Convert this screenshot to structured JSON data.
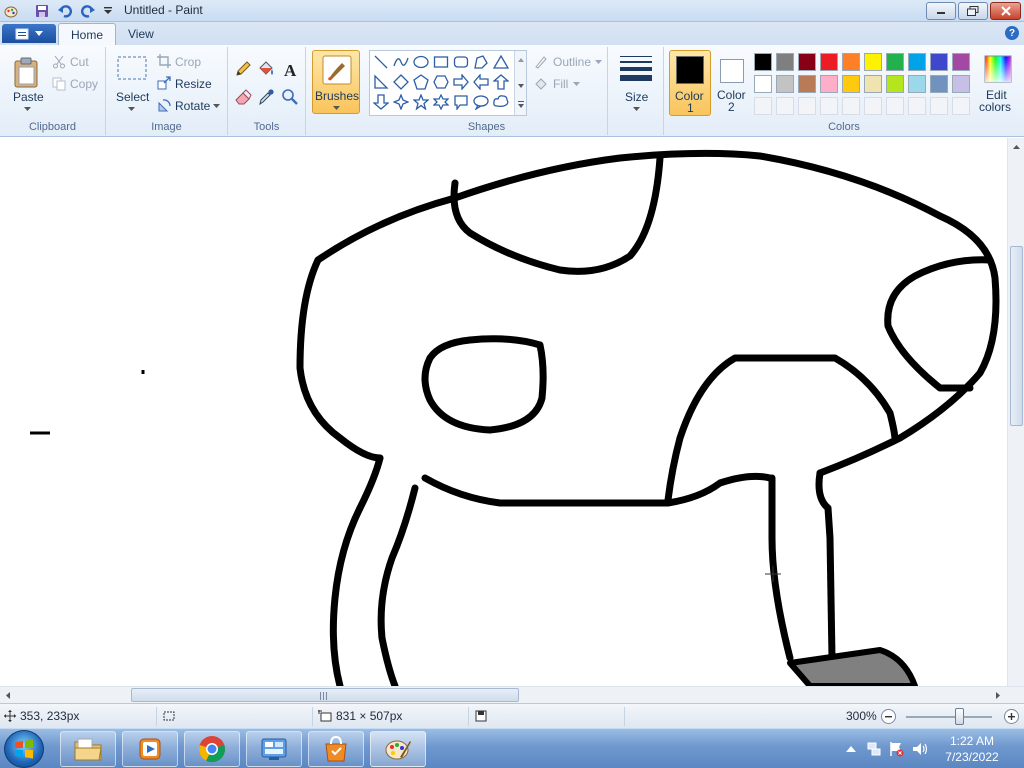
{
  "window": {
    "title": "Untitled - Paint"
  },
  "tabs": {
    "home": "Home",
    "view": "View"
  },
  "ribbon": {
    "clipboard": {
      "paste": "Paste",
      "cut": "Cut",
      "copy": "Copy",
      "group": "Clipboard"
    },
    "image": {
      "select": "Select",
      "crop": "Crop",
      "resize": "Resize",
      "rotate": "Rotate",
      "group": "Image"
    },
    "tools": {
      "group": "Tools"
    },
    "brushes": {
      "label": "Brushes"
    },
    "shapes": {
      "outline": "Outline",
      "fill": "Fill",
      "group": "Shapes"
    },
    "size": {
      "label": "Size"
    },
    "colors": {
      "color1": "Color",
      "color1_num": "1",
      "color2": "Color",
      "color2_num": "2",
      "edit_line1": "Edit",
      "edit_line2": "colors",
      "group": "Colors",
      "primary": "#000000",
      "secondary": "#ffffff",
      "palette_row1": [
        "#000000",
        "#7f7f7f",
        "#880015",
        "#ed1c24",
        "#ff7f27",
        "#fff200",
        "#22b14c",
        "#00a2e8",
        "#3f48cc",
        "#a349a4"
      ],
      "palette_row2": [
        "#ffffff",
        "#c3c3c3",
        "#b97a57",
        "#ffaec9",
        "#ffc90e",
        "#efe4b0",
        "#b5e61d",
        "#99d9ea",
        "#7092be",
        "#c8bfe7"
      ]
    }
  },
  "status": {
    "cursor_pos": "353, 233px",
    "image_size": "831 × 507px",
    "zoom": "300%"
  },
  "taskbar": {
    "time": "1:22 AM",
    "date": "7/23/2022"
  }
}
